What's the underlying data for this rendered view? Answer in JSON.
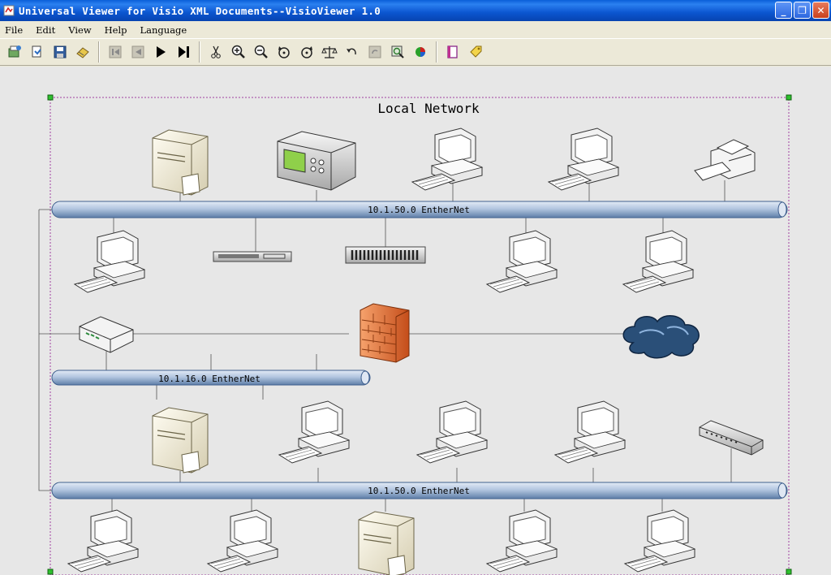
{
  "window": {
    "title": "Universal Viewer for Visio XML Documents--VisioViewer 1.0",
    "minimize_label": "_",
    "maximize_label": "❐",
    "close_label": "✕"
  },
  "menu": {
    "items": [
      {
        "label": "File"
      },
      {
        "label": "Edit"
      },
      {
        "label": "View"
      },
      {
        "label": "Help"
      },
      {
        "label": "Language"
      }
    ]
  },
  "toolbar": {
    "buttons": [
      {
        "icon": "open-icon"
      },
      {
        "icon": "open-file-icon"
      },
      {
        "icon": "save-icon"
      },
      {
        "icon": "export-icon"
      },
      {
        "icon": "first-page-icon"
      },
      {
        "icon": "previous-page-icon"
      },
      {
        "icon": "next-page-icon"
      },
      {
        "icon": "last-page-icon"
      },
      {
        "icon": "cut-icon"
      },
      {
        "icon": "zoom-in-icon"
      },
      {
        "icon": "zoom-out-icon"
      },
      {
        "icon": "rotate-left-icon"
      },
      {
        "icon": "rotate-right-icon"
      },
      {
        "icon": "balance-icon"
      },
      {
        "icon": "undo-icon"
      },
      {
        "icon": "redo-icon"
      },
      {
        "icon": "zoom-fit-icon"
      },
      {
        "icon": "color-icon"
      },
      {
        "icon": "book-icon"
      },
      {
        "icon": "tag-icon"
      }
    ]
  },
  "diagram": {
    "title": "Local Network",
    "bus_top": "10.1.50.0 EntherNet",
    "bus_middle": "10.1.16.0 EntherNet",
    "bus_bottom": "10.1.50.0 EntherNet"
  },
  "colors": {
    "bus_fill": "#b3c6e0",
    "bus_stroke": "#3f5f8e",
    "selection": "#a040a0",
    "firewall": "#e8763a",
    "cloud": "#2a4f78"
  }
}
